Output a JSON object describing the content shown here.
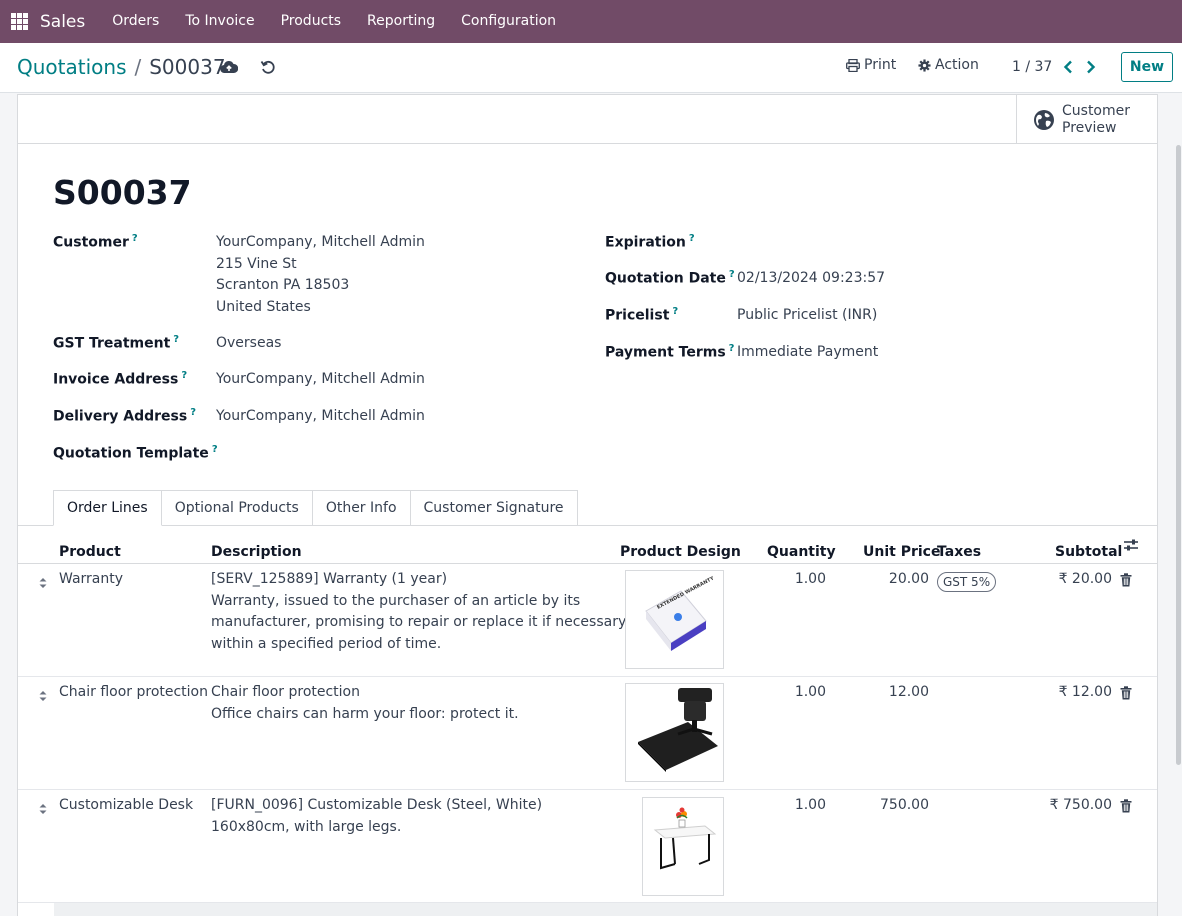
{
  "navbar": {
    "app_name": "Sales",
    "menu": [
      "Orders",
      "To Invoice",
      "Products",
      "Reporting",
      "Configuration"
    ]
  },
  "control_panel": {
    "breadcrumb_parent": "Quotations",
    "breadcrumb_separator": "/",
    "breadcrumb_current": "S00037",
    "print_label": "Print",
    "action_label": "Action",
    "pager": "1 / 37",
    "new_label": "New"
  },
  "statusbar": {
    "preview_line1": "Customer",
    "preview_line2": "Preview"
  },
  "form": {
    "title": "S00037",
    "help_mark": "?",
    "customer_label": "Customer",
    "customer_lines": [
      "YourCompany, Mitchell Admin",
      "215 Vine St",
      "Scranton PA 18503",
      "United States"
    ],
    "gst_label": "GST Treatment",
    "gst_value": "Overseas",
    "invoice_address_label": "Invoice Address",
    "invoice_address_value": "YourCompany, Mitchell Admin",
    "delivery_address_label": "Delivery Address",
    "delivery_address_value": "YourCompany, Mitchell Admin",
    "template_label": "Quotation Template",
    "expiration_label": "Expiration",
    "quotation_date_label": "Quotation Date",
    "quotation_date_value": "02/13/2024 09:23:57",
    "pricelist_label": "Pricelist",
    "pricelist_value": "Public Pricelist (INR)",
    "payment_terms_label": "Payment Terms",
    "payment_terms_value": "Immediate Payment"
  },
  "tabs": [
    "Order Lines",
    "Optional Products",
    "Other Info",
    "Customer Signature"
  ],
  "table": {
    "headers": {
      "product": "Product",
      "description": "Description",
      "design": "Product Design",
      "quantity": "Quantity",
      "unit_price": "Unit Price",
      "taxes": "Taxes",
      "subtotal": "Subtotal"
    },
    "rows": [
      {
        "product": "Warranty",
        "description": [
          "[SERV_125889] Warranty (1 year)",
          "Warranty, issued to the purchaser of an article by its",
          "manufacturer, promising to repair or replace it if necessary",
          "within a specified period of time."
        ],
        "quantity": "1.00",
        "unit_price": "20.00",
        "tax": "GST 5%",
        "subtotal": "₹ 20.00",
        "image_text": "EXTENDED WARRANTY"
      },
      {
        "product": "Chair floor protection",
        "description": [
          "Chair floor protection",
          "Office chairs can harm your floor: protect it."
        ],
        "quantity": "1.00",
        "unit_price": "12.00",
        "tax": "",
        "subtotal": "₹ 12.00"
      },
      {
        "product": "Customizable Desk",
        "description": [
          "[FURN_0096] Customizable Desk (Steel, White)",
          "160x80cm, with large legs."
        ],
        "quantity": "1.00",
        "unit_price": "750.00",
        "tax": "",
        "subtotal": "₹ 750.00"
      }
    ]
  },
  "colors": {
    "navbar": "#714b67",
    "accent": "#017e84"
  }
}
